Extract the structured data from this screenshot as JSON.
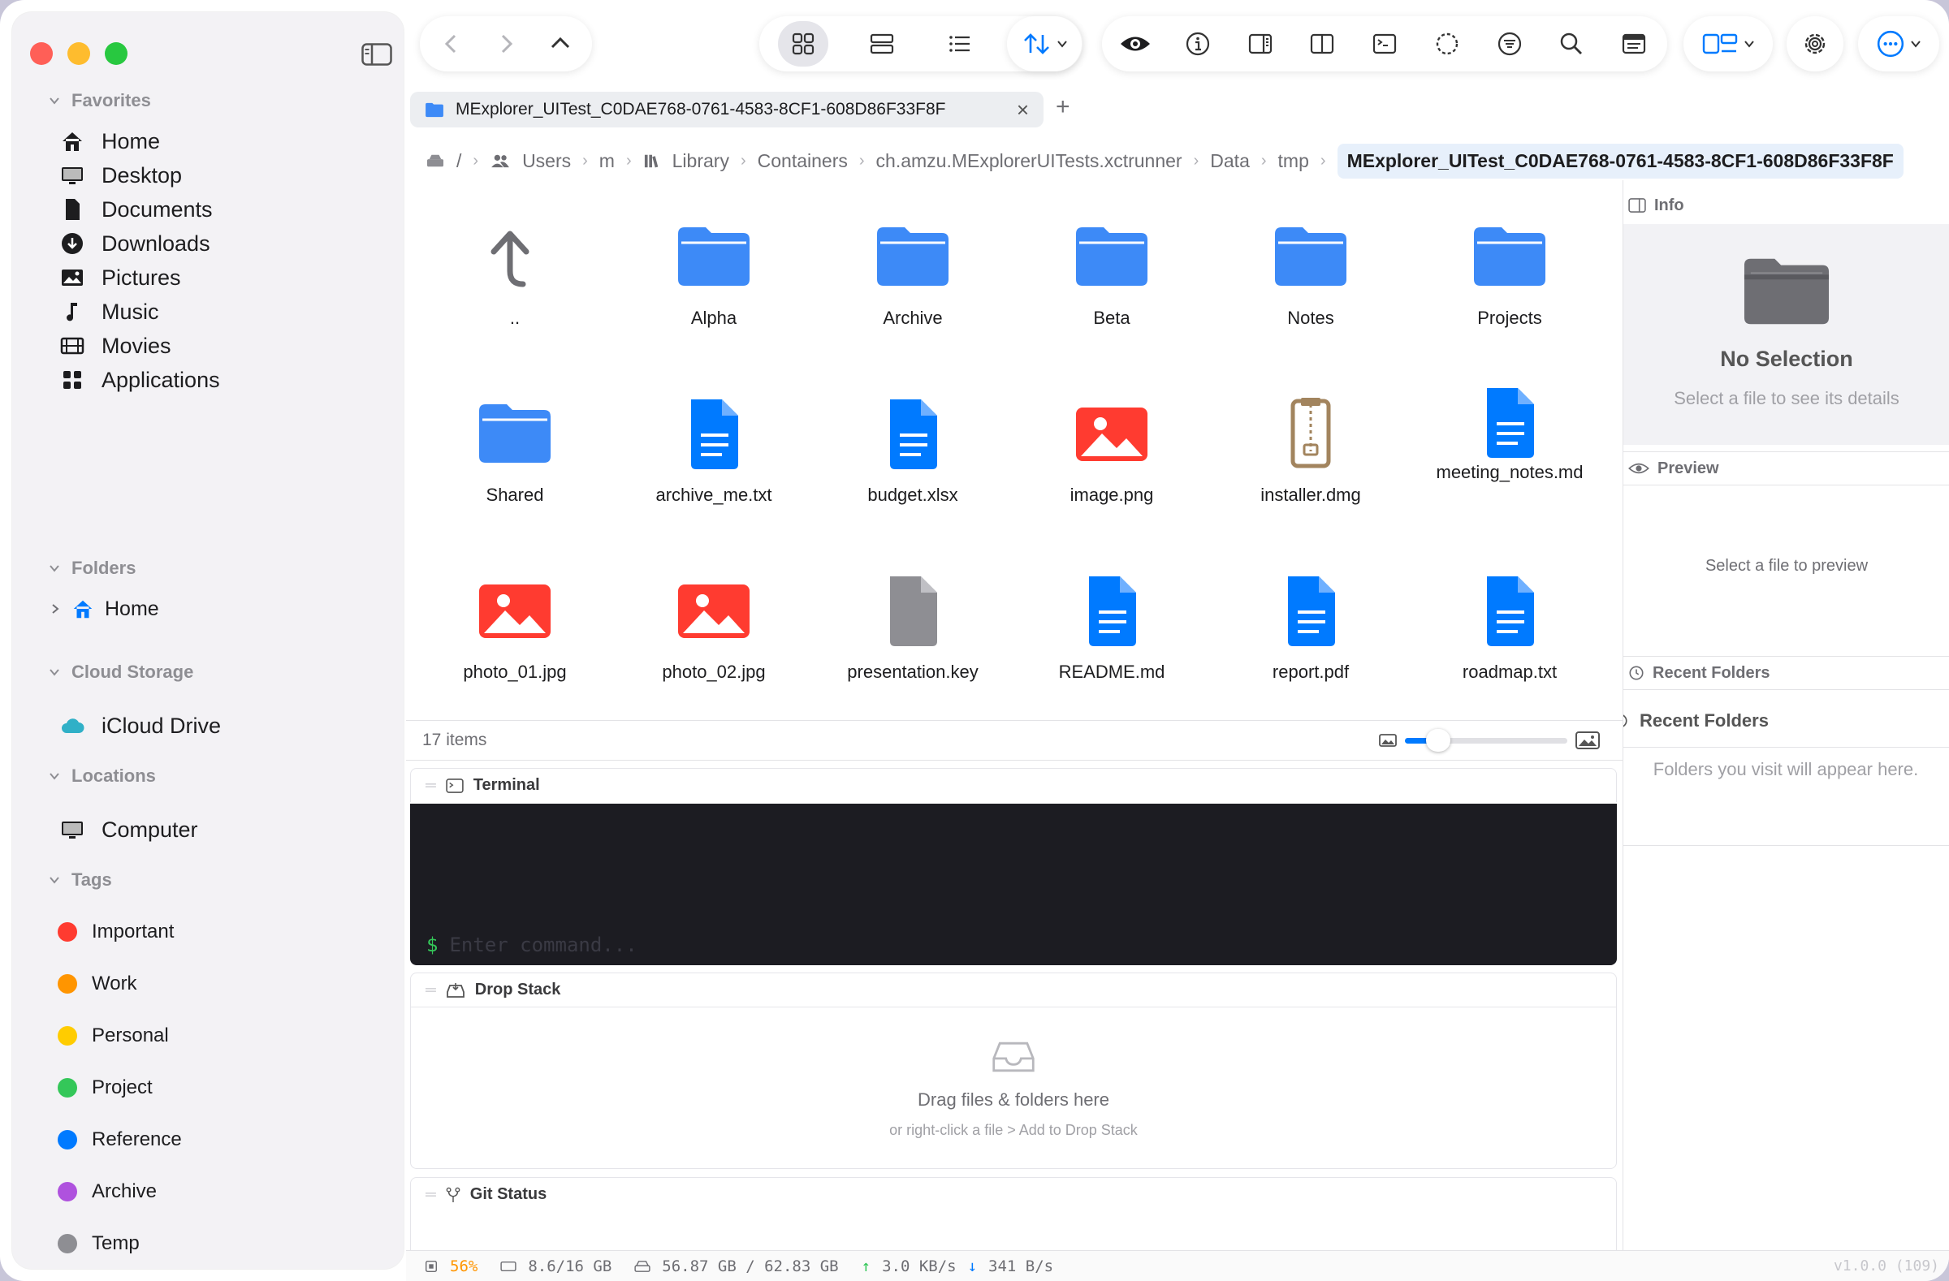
{
  "sidebar": {
    "favorites_header": "Favorites",
    "favorites": [
      {
        "label": "Home",
        "icon": "house-icon"
      },
      {
        "label": "Desktop",
        "icon": "desktop-icon"
      },
      {
        "label": "Documents",
        "icon": "document-icon"
      },
      {
        "label": "Downloads",
        "icon": "download-icon"
      },
      {
        "label": "Pictures",
        "icon": "photo-icon"
      },
      {
        "label": "Music",
        "icon": "music-note-icon"
      },
      {
        "label": "Movies",
        "icon": "film-icon"
      },
      {
        "label": "Applications",
        "icon": "grid-apps-icon"
      }
    ],
    "folders_header": "Folders",
    "folders_item": "Home",
    "cloud_header": "Cloud Storage",
    "cloud_item": "iCloud Drive",
    "locations_header": "Locations",
    "locations_item": "Computer",
    "tags_header": "Tags",
    "tags": [
      {
        "label": "Important",
        "color": "#ff3b30"
      },
      {
        "label": "Work",
        "color": "#ff9500"
      },
      {
        "label": "Personal",
        "color": "#ffcc00"
      },
      {
        "label": "Project",
        "color": "#34c759"
      },
      {
        "label": "Reference",
        "color": "#007aff"
      },
      {
        "label": "Archive",
        "color": "#af52de"
      },
      {
        "label": "Temp",
        "color": "#8e8e93"
      }
    ]
  },
  "tab": {
    "title": "MExplorer_UITest_C0DAE768-0761-4583-8CF1-608D86F33F8F",
    "close": "×",
    "add": "+"
  },
  "breadcrumb": {
    "root": "/",
    "items": [
      "Users",
      "m",
      "Library",
      "Containers",
      "ch.amzu.MExplorerUITests.xctrunner",
      "Data",
      "tmp"
    ],
    "current": "MExplorer_UITest_C0DAE768-0761-4583-8CF1-608D86F33F8F"
  },
  "files": [
    {
      "name": "..",
      "kind": "up"
    },
    {
      "name": "Alpha",
      "kind": "folder"
    },
    {
      "name": "Archive",
      "kind": "folder"
    },
    {
      "name": "Beta",
      "kind": "folder"
    },
    {
      "name": "Notes",
      "kind": "folder"
    },
    {
      "name": "Projects",
      "kind": "folder"
    },
    {
      "name": "Shared",
      "kind": "folder"
    },
    {
      "name": "archive_me.txt",
      "kind": "doc"
    },
    {
      "name": "budget.xlsx",
      "kind": "doc"
    },
    {
      "name": "image.png",
      "kind": "image"
    },
    {
      "name": "installer.dmg",
      "kind": "zip"
    },
    {
      "name": "meeting_notes.md",
      "kind": "doc"
    },
    {
      "name": "photo_01.jpg",
      "kind": "image"
    },
    {
      "name": "photo_02.jpg",
      "kind": "image"
    },
    {
      "name": "presentation.key",
      "kind": "generic"
    },
    {
      "name": "README.md",
      "kind": "doc"
    },
    {
      "name": "report.pdf",
      "kind": "doc"
    },
    {
      "name": "roadmap.txt",
      "kind": "doc"
    }
  ],
  "status": {
    "items_count": "17 items",
    "zoom_level": 0.15
  },
  "panels": {
    "terminal_title": "Terminal",
    "terminal_prompt": "$",
    "terminal_placeholder": "Enter command...",
    "dropstack_title": "Drop Stack",
    "dropstack_main": "Drag files & folders here",
    "dropstack_sub": "or right-click a file > Add to Drop Stack",
    "git_title": "Git Status"
  },
  "right": {
    "info_header": "Info",
    "no_selection": "No Selection",
    "no_selection_sub": "Select a file to see its details",
    "preview_header": "Preview",
    "preview_sub": "Select a file to preview",
    "recent_header": "Recent Folders",
    "recent_title": "Recent Folders",
    "recent_sub": "Folders you visit will appear here."
  },
  "footer": {
    "cpu": "56%",
    "mem": "8.6/16 GB",
    "disk": "56.87 GB / 62.83 GB",
    "up": "3.0 KB/s",
    "down": "341 B/s",
    "version": "v1.0.0 (109)"
  },
  "colors": {
    "accent": "#007aff",
    "folder": "#3d8af7",
    "image": "#ff3b30",
    "zip": "#a2845e",
    "generic": "#8e8e93"
  }
}
